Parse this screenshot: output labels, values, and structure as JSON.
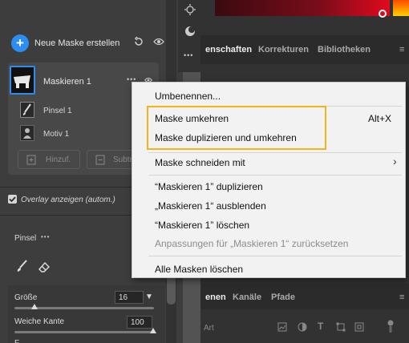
{
  "mask_panel": {
    "create_label": "Neue Maske erstellen",
    "mask_name": "Maskieren 1",
    "sub_items": [
      "Pinsel 1",
      "Motiv 1"
    ],
    "add_label": "Hinzuf.",
    "subtract_label": "Subtra",
    "overlay_label": "Overlay anzeigen (autom.)",
    "brush_label": "Pinsel",
    "brush_more": "•••",
    "size_label": "Größe",
    "size_value": "16",
    "feather_label": "Weiche Kante",
    "feather_value": "100"
  },
  "right_panel": {
    "tabs": [
      "enschaften",
      "Korrekturen",
      "Bibliotheken"
    ],
    "bottom_tabs": [
      "enen",
      "Kanäle",
      "Pfade"
    ],
    "filter_label": "Art"
  },
  "context_menu": {
    "items": [
      {
        "label": "Umbenennen...",
        "shortcut": "",
        "disabled": false
      },
      {
        "label": "Maske umkehren",
        "shortcut": "Alt+X",
        "disabled": false
      },
      {
        "label": "Maske duplizieren und umkehren",
        "shortcut": "",
        "disabled": false
      },
      {
        "label": "Maske schneiden mit",
        "shortcut": "",
        "disabled": false
      },
      {
        "label": "“Maskieren 1” duplizieren",
        "shortcut": "",
        "disabled": false
      },
      {
        "label": "„Maskieren 1“ ausblenden",
        "shortcut": "",
        "disabled": false
      },
      {
        "label": "“Maskieren 1” löschen",
        "shortcut": "",
        "disabled": false
      },
      {
        "label": "Anpassungen für „Maskieren 1“ zurücksetzen",
        "shortcut": "",
        "disabled": true
      },
      {
        "label": "Alle Masken löschen",
        "shortcut": "",
        "disabled": false
      }
    ],
    "submenu_arrow": "›"
  },
  "colors": {
    "accent": "#2b8ef0",
    "highlight": "#f0b41c",
    "menu_bg": "#f2f2f2",
    "panel_bg": "#3d3d3d"
  }
}
